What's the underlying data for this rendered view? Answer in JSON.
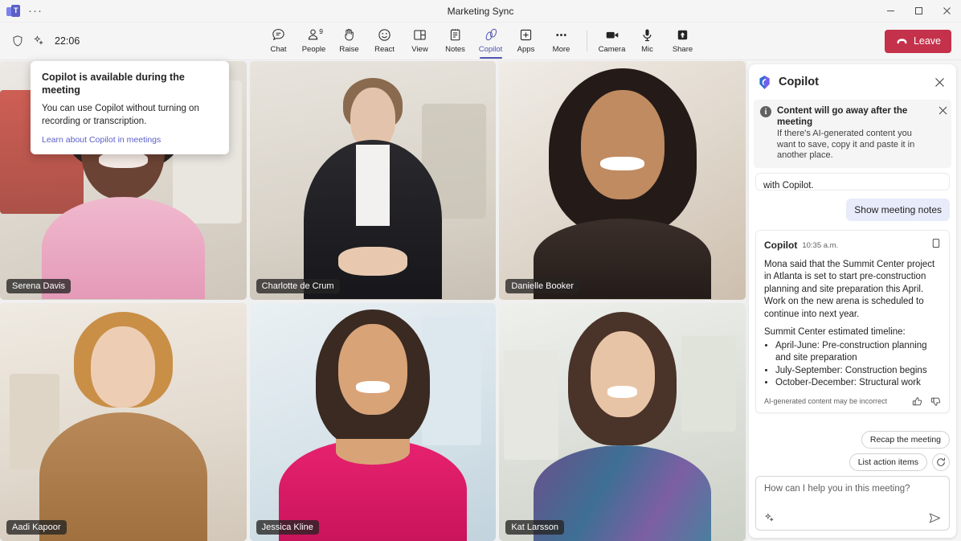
{
  "window": {
    "title": "Marketing Sync",
    "logo_alt": "teams-logo",
    "overflow_label": "···",
    "minimize_label": "Minimize",
    "maximize_label": "Maximize",
    "close_label": "Close"
  },
  "toolbar": {
    "clock": "22:06",
    "shield_label": "shield-icon",
    "sparkle_label": "sparkle-icon",
    "items": [
      {
        "label": "Chat",
        "icon": "chat-icon",
        "active": false,
        "badge": ""
      },
      {
        "label": "People",
        "icon": "people-icon",
        "active": false,
        "badge": "9"
      },
      {
        "label": "Raise",
        "icon": "raise-hand-icon",
        "active": false,
        "badge": ""
      },
      {
        "label": "React",
        "icon": "react-smiley-icon",
        "active": false,
        "badge": ""
      },
      {
        "label": "View",
        "icon": "view-layout-icon",
        "active": false,
        "badge": ""
      },
      {
        "label": "Notes",
        "icon": "notes-icon",
        "active": false,
        "badge": ""
      },
      {
        "label": "Copilot",
        "icon": "copilot-icon",
        "active": true,
        "badge": ""
      },
      {
        "label": "Apps",
        "icon": "apps-plus-icon",
        "active": false,
        "badge": ""
      },
      {
        "label": "More",
        "icon": "more-ellipsis-icon",
        "active": false,
        "badge": ""
      }
    ],
    "call_controls": [
      {
        "label": "Camera",
        "icon": "camera-icon"
      },
      {
        "label": "Mic",
        "icon": "microphone-icon"
      },
      {
        "label": "Share",
        "icon": "share-screen-icon"
      }
    ],
    "leave_label": "Leave",
    "leave_color": "#c4314b"
  },
  "callout": {
    "title": "Copilot is available during the meeting",
    "body": "You can use Copilot without turning on recording or transcription.",
    "link": "Learn about Copilot in meetings"
  },
  "stage": {
    "participants": [
      {
        "name": "Serena Davis"
      },
      {
        "name": "Charlotte de Crum"
      },
      {
        "name": "Danielle Booker"
      },
      {
        "name": "Aadi Kapoor"
      },
      {
        "name": "Jessica Kline"
      },
      {
        "name": "Kat Larsson"
      }
    ]
  },
  "copilot": {
    "title": "Copilot",
    "close_label": "Close",
    "banner": {
      "title": "Content will go away after the meeting",
      "body": "If there's AI-generated content you want to save, copy it and paste it in another place.",
      "dismiss_label": "Dismiss"
    },
    "clipped_message": "with Copilot.",
    "user_message": "Show meeting notes",
    "response": {
      "author": "Copilot",
      "time": "10:35 a.m.",
      "copy_label": "copy-icon",
      "paragraph": "Mona said that the Summit Center project in Atlanta is set to start pre-construction planning and site preparation this April. Work on the new arena is scheduled to continue into next year.",
      "list_title": "Summit Center estimated timeline:",
      "bullets": [
        "April-June: Pre-construction planning and site preparation",
        "July-September: Construction begins",
        "October-December: Structural work"
      ],
      "disclaimer": "AI-generated content may be incorrect",
      "thumbs_up_label": "thumbs-up-icon",
      "thumbs_down_label": "thumbs-down-icon"
    },
    "suggestions": [
      "Recap the meeting",
      "List action items"
    ],
    "refresh_label": "refresh-icon",
    "compose": {
      "placeholder": "How can I help you in this meeting?",
      "sparkle_label": "sparkle-icon",
      "send_label": "send-icon"
    }
  },
  "colors": {
    "accent": "#5b5fc7",
    "accent_active": "#4f52b2",
    "leave": "#c4314b",
    "user_bubble": "#e8ebfa",
    "panel_bg": "#ffffff",
    "app_bg": "#f5f5f5"
  }
}
